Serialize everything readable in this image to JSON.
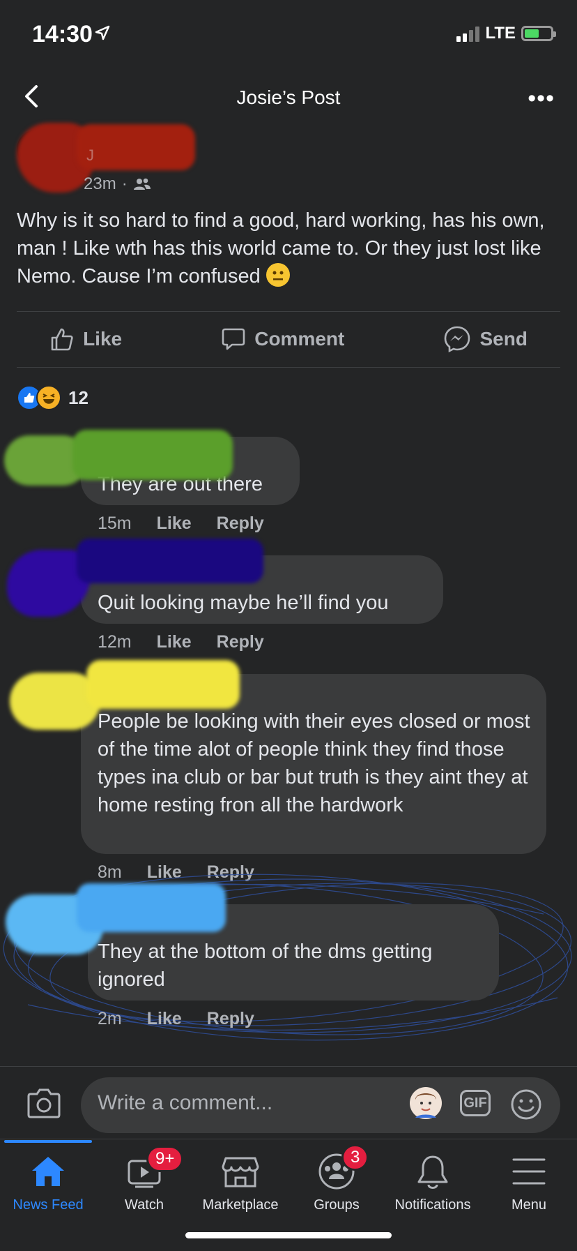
{
  "status": {
    "time": "14:30",
    "network": "LTE"
  },
  "header": {
    "title": "Josie’s Post",
    "more": "•••"
  },
  "post": {
    "author_initial": "J",
    "time": "23m",
    "audience_sep": "·",
    "text": "Why is it so hard to find a good, hard working, has his own, man ! Like wth has this world came to. Or they just lost like Nemo. Cause I’m confused"
  },
  "actions": {
    "like": "Like",
    "comment": "Comment",
    "send": "Send"
  },
  "reactions": {
    "count": "12"
  },
  "comment_actions": {
    "like": "Like",
    "reply": "Reply"
  },
  "comments": [
    {
      "text": "They are out there",
      "time": "15m"
    },
    {
      "text": "Quit looking maybe he’ll find you",
      "time": "12m"
    },
    {
      "text": "People be looking with their eyes closed or most of the time alot of people think they find those types ina club or bar but truth is they aint they at home resting fron all the hardwork",
      "time": "8m"
    },
    {
      "text": "They at the bottom of the dms getting ignored",
      "time": "2m"
    }
  ],
  "composer": {
    "placeholder": "Write a comment...",
    "gif": "GIF"
  },
  "tabs": [
    {
      "label": "News Feed"
    },
    {
      "label": "Watch",
      "badge": "9+"
    },
    {
      "label": "Marketplace"
    },
    {
      "label": "Groups",
      "badge": "3"
    },
    {
      "label": "Notifications"
    },
    {
      "label": "Menu"
    }
  ],
  "colors": {
    "accent": "#2d88ff",
    "badge": "#e41e3f",
    "background": "#242526",
    "bubble": "#3a3b3c"
  }
}
